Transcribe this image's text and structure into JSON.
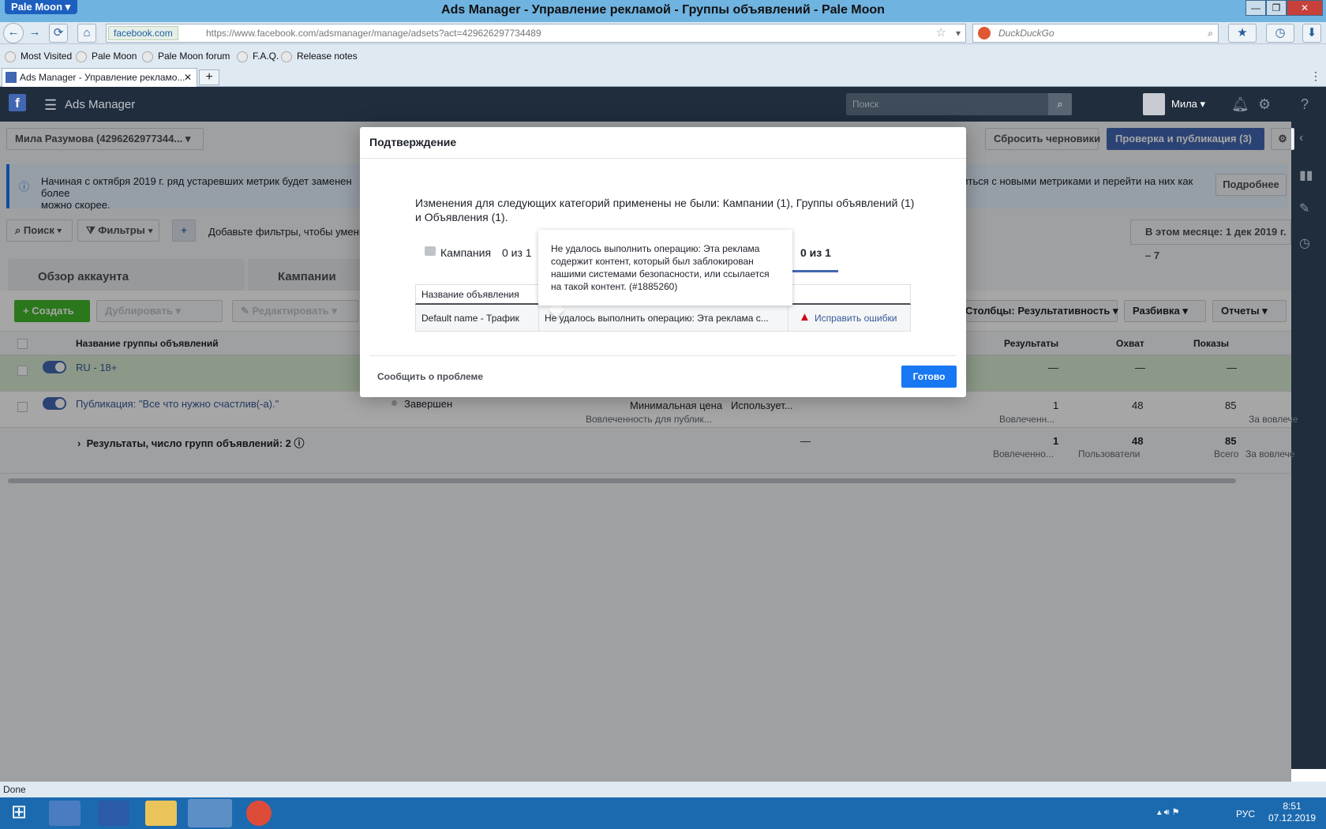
{
  "browser": {
    "menu_button": "Pale Moon",
    "window_title": "Ads Manager - Управление рекламой - Группы объявлений - Pale Moon",
    "site_identity": "facebook.com",
    "url": "https://www.facebook.com/adsmanager/manage/adsets?act=429626297734489",
    "search_placeholder": "DuckDuckGo",
    "bookmarks": [
      "Most Visited",
      "Pale Moon",
      "Pale Moon forum",
      "F.A.Q.",
      "Release notes"
    ],
    "tab_title": "Ads Manager - Управление рекламо...",
    "status_text": "Done"
  },
  "fb": {
    "app_name": "Ads Manager",
    "search_placeholder": "Поиск",
    "user_name": "Мила",
    "account_selector": "Мила Разумова (4296262977344...",
    "reset_drafts": "Сбросить черновики",
    "review_publish": "Проверка и публикация (3)",
    "notice_text": "Начиная с октября 2019 г. ряд устаревших метрик будет заменен более",
    "notice_text_2": "можно скорее.",
    "notice_right": "акомиться с новыми метриками и перейти на них как",
    "learn_more": "Подробнее",
    "search_btn": "Поиск",
    "filters_btn": "Фильтры",
    "filter_hint": "Добавьте фильтры, чтобы умень",
    "date_range": "В этом месяце: 1 дек 2019 г. – 7",
    "tab_overview": "Обзор аккаунта",
    "tab_campaigns": "Кампании",
    "create": "Создать",
    "duplicate": "Дублировать",
    "edit": "Редактировать",
    "columns": "Столбцы: Результативность",
    "breakdown": "Разбивка",
    "reports": "Отчеты",
    "table": {
      "col_name": "Название группы объявлений",
      "col_results": "Результаты",
      "col_reach": "Охват",
      "col_impressions": "Показы",
      "rows": [
        {
          "name": "RU - 18+",
          "results": "—",
          "reach": "—",
          "impressions": "—"
        },
        {
          "name": "Публикация: \"Все что нужно счастлив(-а).\"",
          "status": "Завершен",
          "bid": "Минимальная цена",
          "bid_sub": "Вовлеченность для публик...",
          "budget": "Использует...",
          "results": "1",
          "results_sub": "Вовлеченн...",
          "reach": "48",
          "impressions": "85",
          "extra_sub": "За вовлече"
        }
      ],
      "summary": {
        "label": "Результаты, число групп объявлений: 2",
        "dash": "—",
        "results": "1",
        "results_sub": "Вовлеченно...",
        "reach": "48",
        "reach_sub": "Пользователи",
        "impressions": "85",
        "impressions_sub": "Всего",
        "extra_sub": "За вовлече"
      }
    }
  },
  "modal": {
    "title": "Подтверждение",
    "message": "Изменения для следующих категорий применены не были: Кампании (1), Группы объявлений (1) и Объявления (1).",
    "campaign_label": "Кампания",
    "campaign_count": "0 из 1",
    "ads_count": "0 из 1",
    "table_header_name": "Название объявления",
    "row_name": "Default name - Трафик",
    "row_error": "Не удалось выполнить операцию: Эта реклама с...",
    "fix_errors": "Исправить ошибки",
    "tooltip": "Не удалось выполнить операцию: Эта реклама содержит контент, который был заблокирован нашими системами безопасности, или ссылается на такой контент. (#1885260)",
    "report_problem": "Сообщить о проблеме",
    "done": "Готово"
  },
  "taskbar": {
    "lang": "РУС",
    "time": "8:51",
    "date": "07.12.2019"
  }
}
